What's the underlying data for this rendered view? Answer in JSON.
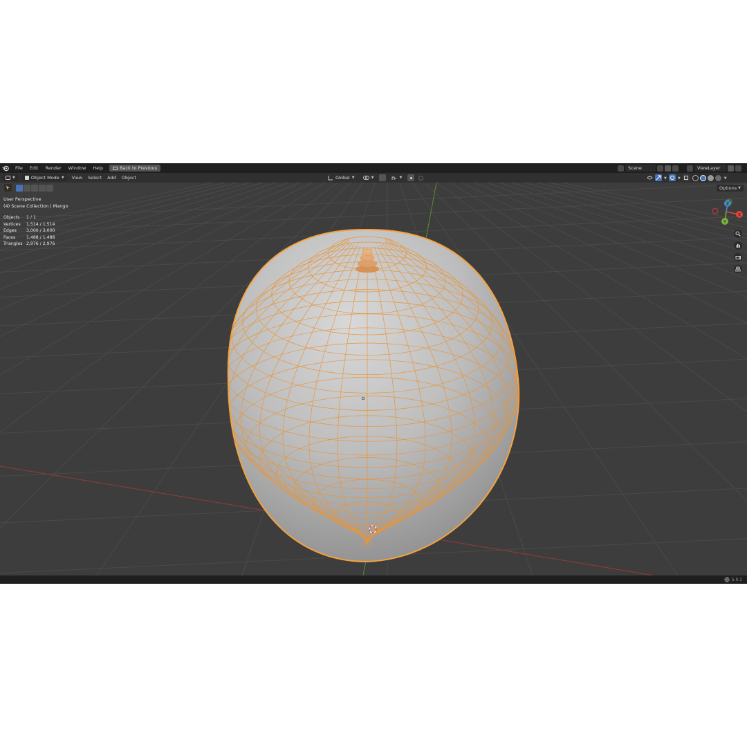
{
  "topbar": {
    "menu": [
      "File",
      "Edit",
      "Render",
      "Window",
      "Help"
    ],
    "back_label": "Back to Previous",
    "scene": "Scene",
    "view_layer": "ViewLayer"
  },
  "header": {
    "mode": "Object Mode",
    "menu": [
      "View",
      "Select",
      "Add",
      "Object"
    ],
    "orientation": "Global"
  },
  "options_label": "Options",
  "overlay": {
    "perspective": "User Perspective",
    "collection": "(4) Scene Collection | Mango"
  },
  "stats": [
    {
      "label": "Objects",
      "value": "1 / 1"
    },
    {
      "label": "Vertices",
      "value": "1,514 / 1,514"
    },
    {
      "label": "Edges",
      "value": "3,000 / 3,000"
    },
    {
      "label": "Faces",
      "value": "1,488 / 1,488"
    },
    {
      "label": "Triangles",
      "value": "2,976 / 2,976"
    }
  ],
  "gizmo": {
    "x": "X",
    "y": "Y",
    "z": "Z"
  },
  "version": "5.0.1",
  "colors": {
    "selection": "#f4a040",
    "x_axis": "#e0453e",
    "y_axis": "#7ab33b",
    "z_axis": "#3d8ee0"
  },
  "icons": [
    "blender-logo-icon",
    "zoom-icon",
    "hand-pan-icon",
    "camera-icon",
    "grid-view-icon",
    "globe-icon"
  ]
}
